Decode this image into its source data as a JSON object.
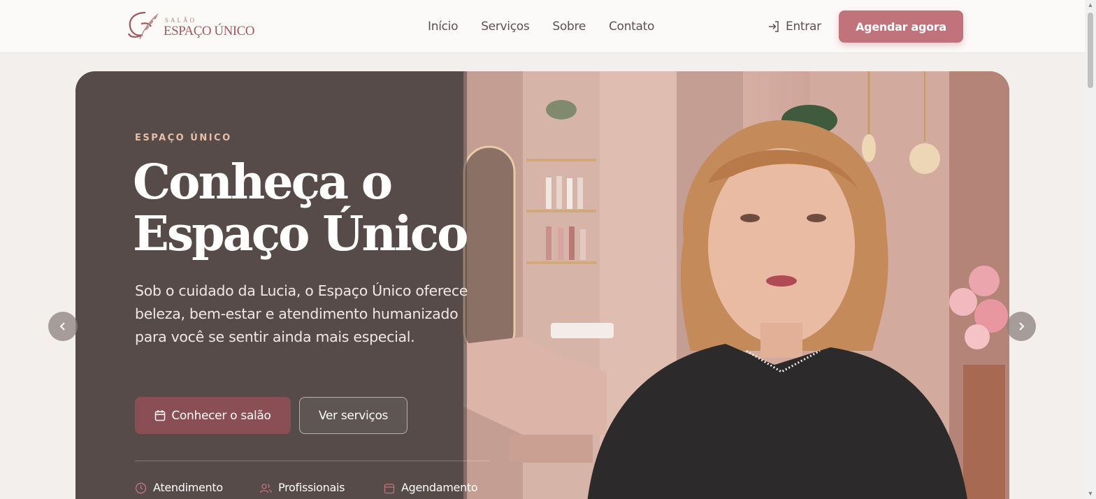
{
  "header": {
    "logo_small": "SALÃO",
    "logo_main": "ESPAÇO ÚNICO",
    "nav": [
      "Início",
      "Serviços",
      "Sobre",
      "Contato"
    ],
    "login_label": "Entrar",
    "cta_label": "Agendar agora"
  },
  "hero": {
    "eyebrow": "ESPAÇO ÚNICO",
    "title": "Conheça o Espaço Único",
    "text": "Sob o cuidado da Lucia, o Espaço Único oferece beleza, bem-estar e atendimento humanizado para você se sentir ainda mais especial.",
    "primary_button": "Conhecer o salão",
    "secondary_button": "Ver serviços",
    "features": [
      "Atendimento",
      "Profissionais",
      "Agendamento"
    ]
  },
  "colors": {
    "accent": "#c0737a",
    "primary_dark": "#8a4f55",
    "eyebrow": "#e7c0a6"
  },
  "icons": {
    "login": "login-icon",
    "calendar": "calendar-icon",
    "clock": "clock-icon",
    "users": "users-icon",
    "prev": "chevron-left-icon",
    "next": "chevron-right-icon"
  }
}
